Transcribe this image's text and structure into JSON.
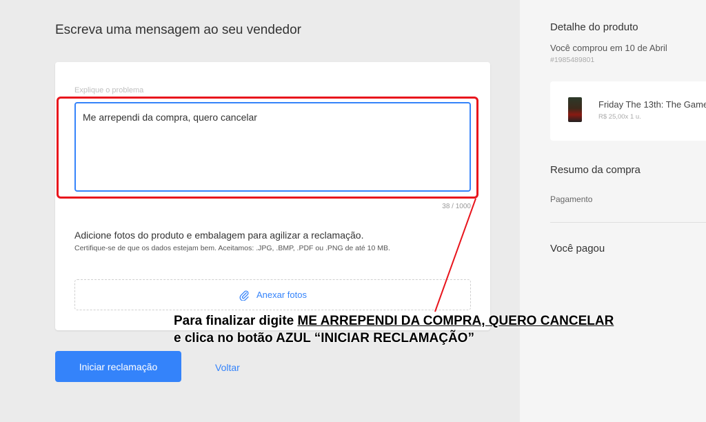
{
  "main": {
    "title": "Escreva uma mensagem ao seu vendedor",
    "field_label": "Explique o problema",
    "message_value": "Me arrependi da compra, quero cancelar",
    "char_counter": "38 / 1000",
    "photos_title": "Adicione fotos do produto e embalagem para agilizar a reclamação.",
    "photos_hint": "Certifique-se de que os dados estejam bem. Aceitamos: .JPG, .BMP, .PDF ou .PNG de até 10 MB.",
    "attach_label": "Anexar fotos",
    "attach_icon": "paperclip-icon",
    "primary_button": "Iniciar reclamação",
    "back_link": "Voltar"
  },
  "annotation": {
    "line1_prefix": "Para finalizar digite ",
    "line1_emphasis": "ME ARREPENDI DA COMPRA, QUERO CANCELAR",
    "line2": "e clica no botão AZUL “INICIAR RECLAMAÇÃO”",
    "color": "#e8141c"
  },
  "aside": {
    "title": "Detalhe do produto",
    "purchase_date": "Você comprou em 10 de Abril",
    "order_id": "#1985489801",
    "product": {
      "name": "Friday The 13th: The Game",
      "price": "R$ 25,00x 1 u."
    },
    "summary_title": "Resumo da compra",
    "payment_label": "Pagamento",
    "paid_label": "Você pagou"
  },
  "colors": {
    "accent": "#3483fa",
    "background": "#ebebeb",
    "highlight": "#e8141c"
  }
}
